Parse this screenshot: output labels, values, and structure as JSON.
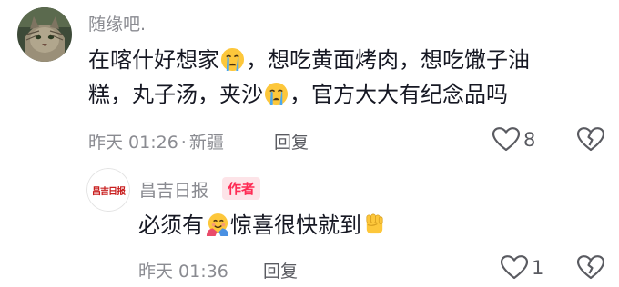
{
  "comment": {
    "username": "随缘吧.",
    "text_line1_a": "在喀什好想家",
    "text_line1_b": "，想吃黄面烤肉，想吃馓子油",
    "text_line2_a": "糕，丸子汤，夹沙",
    "text_line2_b": "，官方大大有纪念品吗",
    "emoji_1": "crying-face-icon",
    "emoji_2": "crying-face-icon",
    "time": "昨天 01:26",
    "separator": "·",
    "location": "新疆",
    "reply_label": "回复",
    "likes": "8"
  },
  "reply": {
    "username": "昌吉日报",
    "logo_text": "昌吉日报",
    "author_badge": "作者",
    "text_a": "必须有",
    "text_b": "惊喜很快就到",
    "emoji_1": "hugging-face-icon",
    "emoji_2": "raised-fist-icon",
    "time": "昨天 01:36",
    "reply_label": "回复",
    "likes": "1"
  },
  "colors": {
    "text_primary": "#161823",
    "text_secondary": "#8a8b91",
    "badge_bg": "#fde4e8",
    "badge_text": "#fe2c55",
    "emoji_yellow": "#fdc73b"
  }
}
